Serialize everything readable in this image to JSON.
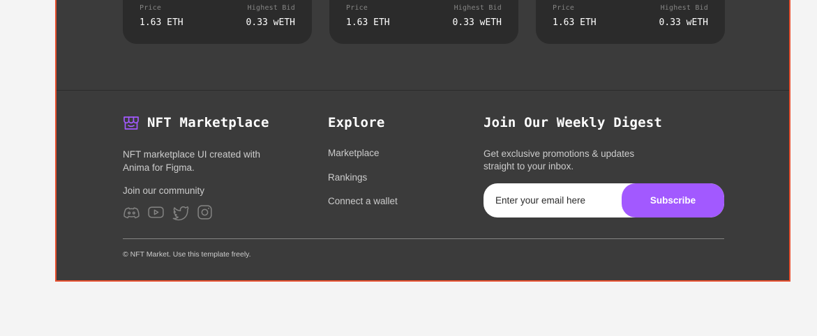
{
  "cards": [
    {
      "price_label": "Price",
      "bid_label": "Highest Bid",
      "price": "1.63 ETH",
      "bid": "0.33 wETH"
    },
    {
      "price_label": "Price",
      "bid_label": "Highest Bid",
      "price": "1.63 ETH",
      "bid": "0.33 wETH"
    },
    {
      "price_label": "Price",
      "bid_label": "Highest Bid",
      "price": "1.63 ETH",
      "bid": "0.33 wETH"
    }
  ],
  "footer": {
    "brand": {
      "icon": "storefront-icon",
      "title": "NFT Marketplace"
    },
    "about": "NFT marketplace UI created with Anima for Figma.",
    "community_label": "Join our community",
    "socials": [
      "discord-icon",
      "youtube-icon",
      "twitter-icon",
      "instagram-icon"
    ],
    "explore": {
      "title": "Explore",
      "links": [
        "Marketplace",
        "Rankings",
        "Connect a wallet"
      ]
    },
    "digest": {
      "title": "Join Our Weekly Digest",
      "text": "Get exclusive promotions & updates straight to your inbox.",
      "email_placeholder": "Enter your email here",
      "subscribe_label": "Subscribe"
    },
    "copyright": "© NFT Market. Use this template freely."
  },
  "colors": {
    "page_bg": "#f4f4f4",
    "frame_bg": "#3b3b3b",
    "card_bg": "#2b2b2b",
    "accent": "#a259ff",
    "frame_border": "#e8502f",
    "muted_text": "#858584",
    "body_text": "#cccccc"
  }
}
